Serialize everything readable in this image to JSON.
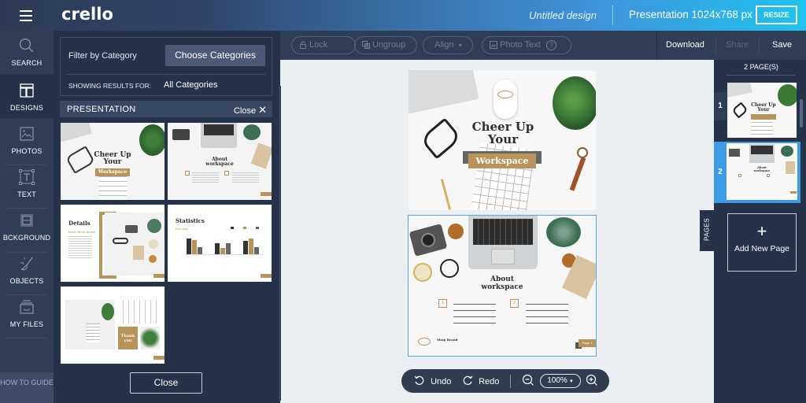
{
  "app": {
    "logo": "crello",
    "design_name": "Untitled design",
    "format_label": "Presentation 1024x768 px",
    "resize_label": "RESIZE"
  },
  "rail": {
    "items": [
      {
        "id": "search",
        "label": "SEARCH",
        "icon": "search-icon",
        "active": false
      },
      {
        "id": "designs",
        "label": "DESIGNS",
        "icon": "layout-icon",
        "active": true
      },
      {
        "id": "photos",
        "label": "PHOTOS",
        "icon": "image-icon",
        "active": false
      },
      {
        "id": "text",
        "label": "TEXT",
        "icon": "text-icon",
        "active": false
      },
      {
        "id": "background",
        "label": "BCKGROUND",
        "icon": "background-icon",
        "active": false
      },
      {
        "id": "objects",
        "label": "OBJECTS",
        "icon": "brush-icon",
        "active": false
      },
      {
        "id": "myfiles",
        "label": "MY FILES",
        "icon": "folder-icon",
        "active": false
      }
    ],
    "how_to_guide": "HOW TO GUIDE"
  },
  "panel": {
    "filter_label": "Filter by Category",
    "choose_categories": "Choose Categories",
    "showing_label": "SHOWING RESULTS FOR:",
    "showing_value": "All Categories",
    "section_title": "PRESENTATION",
    "section_close": "Close",
    "close_button": "Close",
    "templates": [
      {
        "title": "Cheer Up Your",
        "ribbon": "Workspace"
      },
      {
        "title": "About workspace"
      },
      {
        "title": "Details",
        "subtitle": "Make life so simple"
      },
      {
        "title": "Statistics",
        "subtitle": "Key data"
      },
      {
        "title": "Thank you"
      }
    ]
  },
  "toolbar": {
    "lock": "Lock",
    "ungroup": "Ungroup",
    "align": "Align",
    "photo_text": "Photo Text",
    "download": "Download",
    "share": "Share",
    "save": "Save"
  },
  "canvas": {
    "slides": [
      {
        "title_line1": "Cheer Up",
        "title_line2": "Your",
        "ribbon": "Workspace"
      },
      {
        "title_line1": "About",
        "title_line2": "workspace",
        "point1_num": "1",
        "point2_num": "2",
        "footer_brand": "Shop Brand",
        "page_tag": "Page 1"
      }
    ]
  },
  "bottombar": {
    "undo": "Undo",
    "redo": "Redo",
    "zoom": "100%"
  },
  "pages": {
    "tab_label": "PAGES",
    "count_label": "2 PAGE(S)",
    "items": [
      {
        "number": "1",
        "selected": false
      },
      {
        "number": "2",
        "selected": true
      }
    ],
    "add_new": "Add New Page",
    "add_plus": "+"
  },
  "colors": {
    "accent_blue": "#3d9be6",
    "gold": "#b8935a",
    "rail_bg": "#2f3d57",
    "panel_bg": "#263249"
  }
}
